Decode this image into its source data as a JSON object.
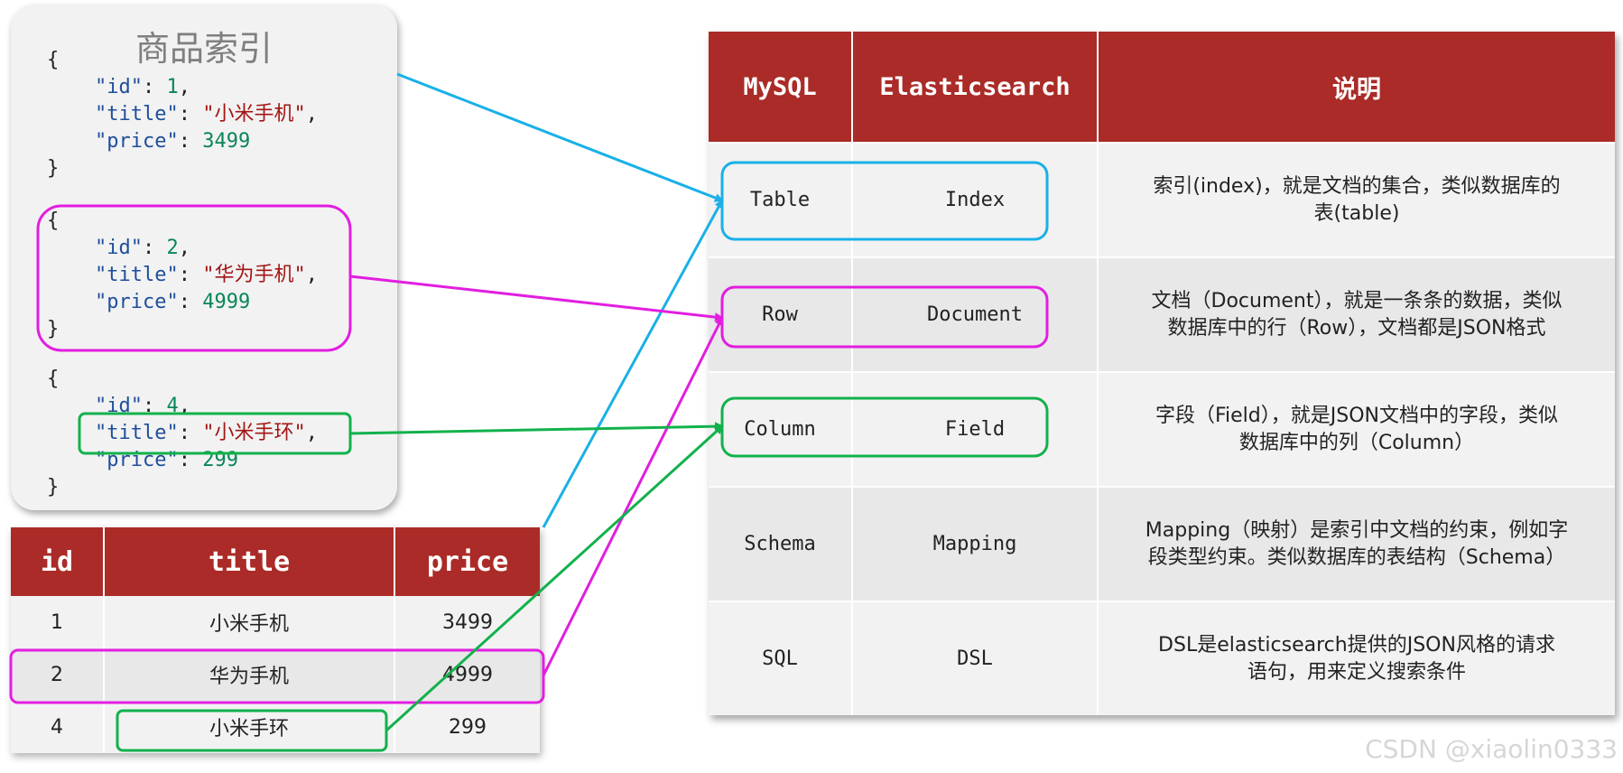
{
  "json_panel": {
    "title": "商品索引",
    "docs": [
      {
        "id_key": "\"id\"",
        "id_val": "1",
        "title_key": "\"title\"",
        "title_val": "\"小米手机\"",
        "price_key": "\"price\"",
        "price_val": "3499"
      },
      {
        "id_key": "\"id\"",
        "id_val": "2",
        "title_key": "\"title\"",
        "title_val": "\"华为手机\"",
        "price_key": "\"price\"",
        "price_val": "4999"
      },
      {
        "id_key": "\"id\"",
        "id_val": "4",
        "title_key": "\"title\"",
        "title_val": "\"小米手环\"",
        "price_key": "\"price\"",
        "price_val": "299"
      }
    ]
  },
  "sql_table": {
    "headers": [
      "id",
      "title",
      "price"
    ],
    "rows": [
      [
        "1",
        "小米手机",
        "3499"
      ],
      [
        "2",
        "华为手机",
        "4999"
      ],
      [
        "4",
        "小米手环",
        "299"
      ]
    ]
  },
  "compare_table": {
    "headers": [
      "MySQL",
      "Elasticsearch",
      "说明"
    ],
    "rows": [
      {
        "mysql": "Table",
        "es": "Index",
        "desc1": "索引(index)，就是文档的集合，类似数据库的",
        "desc2": "表(table)"
      },
      {
        "mysql": "Row",
        "es": "Document",
        "desc1": "文档（Document），就是一条条的数据，类似",
        "desc2": "数据库中的行（Row），文档都是JSON格式"
      },
      {
        "mysql": "Column",
        "es": "Field",
        "desc1": "字段（Field），就是JSON文档中的字段，类似",
        "desc2": "数据库中的列（Column）"
      },
      {
        "mysql": "Schema",
        "es": "Mapping",
        "desc1": "Mapping（映射）是索引中文档的约束，例如字",
        "desc2": "段类型约束。类似数据库的表结构（Schema）"
      },
      {
        "mysql": "SQL",
        "es": "DSL",
        "desc1": "DSL是elasticsearch提供的JSON风格的请求",
        "desc2": "语句，用来定义搜索条件"
      }
    ]
  },
  "colors": {
    "header_red": "#aa2b27",
    "blue": "#1ab0e8",
    "magenta": "#e21ee0",
    "green": "#12b14c"
  },
  "watermark": "CSDN @xiaolin0333"
}
